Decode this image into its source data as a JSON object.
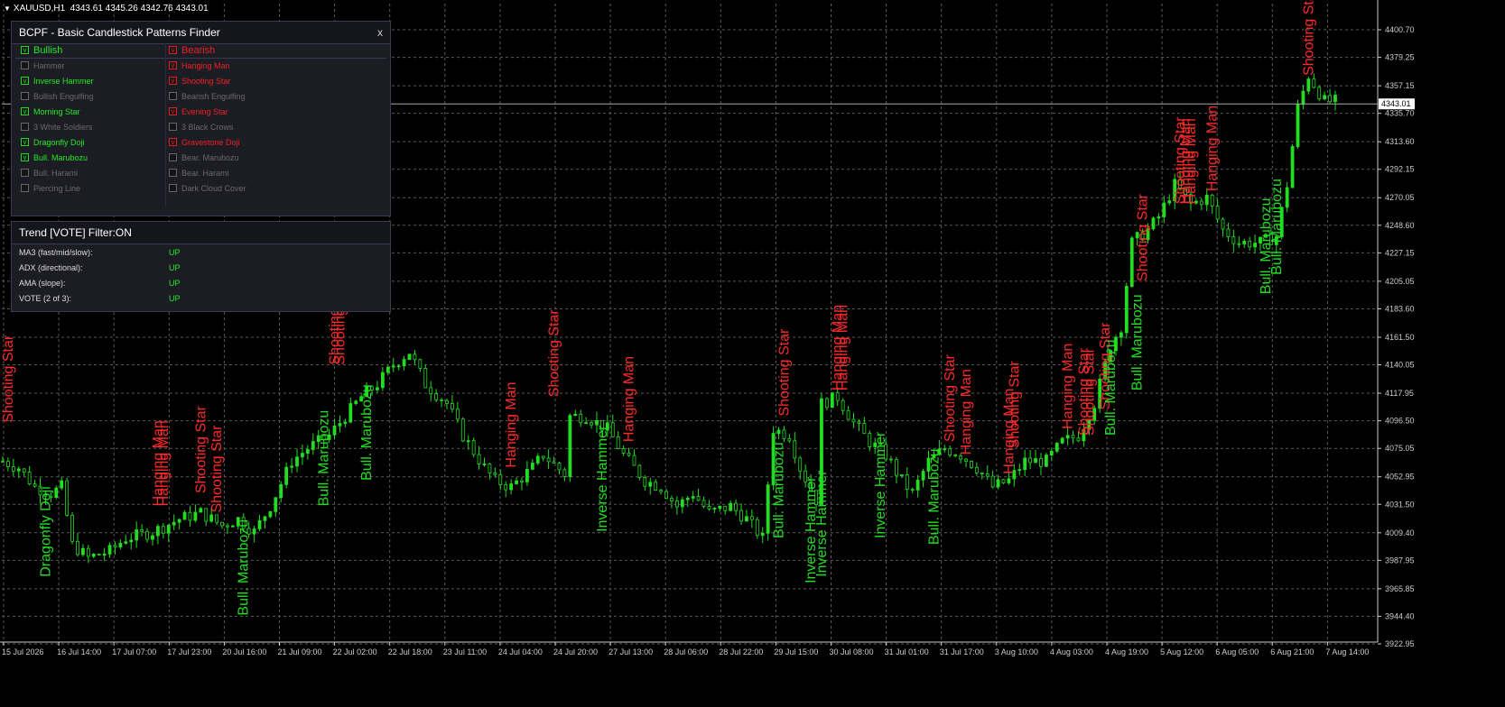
{
  "symbol": {
    "name": "XAUUSD,H1",
    "ohlc": "4343.61 4345.26 4342.76 4343.01"
  },
  "colors": {
    "background": "#000000",
    "grid": "#5a5a5a",
    "bull": "#22dd22",
    "bear": "#ff2a2a",
    "axis": "#cccccc"
  },
  "panel": {
    "title": "BCPF - Basic Candlestick Patterns Finder",
    "close": "x",
    "bullish_header": "Bullish",
    "bearish_header": "Bearish",
    "bullish": [
      {
        "label": "Hammer",
        "checked": false
      },
      {
        "label": "Inverse Hammer",
        "checked": true
      },
      {
        "label": "Bullish Engulfing",
        "checked": false
      },
      {
        "label": "Morning Star",
        "checked": true
      },
      {
        "label": "3 White Soldiers",
        "checked": false
      },
      {
        "label": "Dragonfly Doji",
        "checked": true
      },
      {
        "label": "Bull. Marubozu",
        "checked": true
      },
      {
        "label": "Bull. Harami",
        "checked": false
      },
      {
        "label": "Piercing Line",
        "checked": false
      }
    ],
    "bearish": [
      {
        "label": "Hanging Man",
        "checked": true
      },
      {
        "label": "Shooting Star",
        "checked": true
      },
      {
        "label": "Bearish Engulfing",
        "checked": false
      },
      {
        "label": "Evening Star",
        "checked": true
      },
      {
        "label": "3 Black Crows",
        "checked": false
      },
      {
        "label": "Gravestone Doji",
        "checked": true
      },
      {
        "label": "Bear. Marubozu",
        "checked": false
      },
      {
        "label": "Bear. Harami",
        "checked": false
      },
      {
        "label": "Dark Cloud Cover",
        "checked": false
      }
    ],
    "check_mark": "v"
  },
  "trend": {
    "title": "Trend [VOTE]  Filter:ON",
    "rows": [
      {
        "label": "MA3 (fast/mid/slow):",
        "value": "UP"
      },
      {
        "label": "ADX (directional):",
        "value": "UP"
      },
      {
        "label": "AMA (slope):",
        "value": "UP"
      },
      {
        "label": "VOTE (2 of 3):",
        "value": "UP"
      }
    ]
  },
  "chart_data": {
    "type": "candlestick",
    "price_axis": [
      "4400.70",
      "4379.25",
      "4357.15",
      "4335.70",
      "4313.60",
      "4292.15",
      "4270.05",
      "4248.60",
      "4227.15",
      "4205.05",
      "4183.60",
      "4161.50",
      "4140.05",
      "4117.95",
      "4096.50",
      "4075.05",
      "4052.95",
      "4031.50",
      "4009.40",
      "3987.95",
      "3965.85",
      "3944.40",
      "3922.95"
    ],
    "time_axis": [
      "15 Jul 2026",
      "16 Jul 14:00",
      "17 Jul 07:00",
      "17 Jul 23:00",
      "20 Jul 16:00",
      "21 Jul 09:00",
      "22 Jul 02:00",
      "22 Jul 18:00",
      "23 Jul 11:00",
      "24 Jul 04:00",
      "24 Jul 20:00",
      "27 Jul 13:00",
      "28 Jul 06:00",
      "28 Jul 22:00",
      "29 Jul 15:00",
      "30 Jul 08:00",
      "31 Jul 01:00",
      "31 Jul 17:00",
      "3 Aug 10:00",
      "4 Aug 03:00",
      "4 Aug 19:00",
      "5 Aug 12:00",
      "6 Aug 05:00",
      "6 Aug 21:00",
      "7 Aug 14:00"
    ],
    "current_price": "4343.01",
    "ylim": [
      3922.95,
      4400.7
    ],
    "price_path": [
      [
        0,
        4065
      ],
      [
        3,
        4060
      ],
      [
        6,
        4045
      ],
      [
        9,
        4040
      ],
      [
        11,
        4045
      ],
      [
        13,
        4000
      ],
      [
        16,
        3990
      ],
      [
        20,
        3995
      ],
      [
        23,
        4005
      ],
      [
        28,
        4010
      ],
      [
        33,
        4020
      ],
      [
        37,
        4025
      ],
      [
        41,
        4015
      ],
      [
        44,
        4020
      ],
      [
        47,
        4010
      ],
      [
        50,
        4030
      ],
      [
        54,
        4065
      ],
      [
        57,
        4075
      ],
      [
        61,
        4085
      ],
      [
        64,
        4100
      ],
      [
        67,
        4115
      ],
      [
        70,
        4125
      ],
      [
        73,
        4140
      ],
      [
        76,
        4150
      ],
      [
        79,
        4125
      ],
      [
        83,
        4110
      ],
      [
        86,
        4085
      ],
      [
        90,
        4060
      ],
      [
        92,
        4050
      ],
      [
        95,
        4045
      ],
      [
        99,
        4060
      ],
      [
        101,
        4070
      ],
      [
        105,
        4055
      ],
      [
        106,
        4100
      ],
      [
        109,
        4100
      ],
      [
        113,
        4090
      ],
      [
        116,
        4070
      ],
      [
        120,
        4050
      ],
      [
        123,
        4045
      ],
      [
        126,
        4030
      ],
      [
        129,
        4040
      ],
      [
        132,
        4025
      ],
      [
        136,
        4030
      ],
      [
        139,
        4020
      ],
      [
        142,
        4005
      ],
      [
        144,
        4090
      ],
      [
        147,
        4085
      ],
      [
        149,
        4060
      ],
      [
        152,
        4035
      ],
      [
        153,
        4110
      ],
      [
        156,
        4115
      ],
      [
        159,
        4095
      ],
      [
        162,
        4080
      ],
      [
        165,
        4070
      ],
      [
        168,
        4050
      ],
      [
        170,
        4040
      ],
      [
        173,
        4065
      ],
      [
        176,
        4075
      ],
      [
        179,
        4070
      ],
      [
        182,
        4060
      ],
      [
        185,
        4045
      ],
      [
        188,
        4050
      ],
      [
        191,
        4065
      ],
      [
        195,
        4065
      ],
      [
        198,
        4080
      ],
      [
        201,
        4085
      ],
      [
        204,
        4110
      ],
      [
        207,
        4155
      ],
      [
        209,
        4170
      ],
      [
        211,
        4235
      ],
      [
        214,
        4245
      ],
      [
        216,
        4255
      ],
      [
        219,
        4280
      ],
      [
        222,
        4265
      ],
      [
        225,
        4270
      ],
      [
        228,
        4245
      ],
      [
        231,
        4235
      ],
      [
        235,
        4235
      ],
      [
        238,
        4240
      ],
      [
        240,
        4280
      ],
      [
        242,
        4340
      ],
      [
        244,
        4365
      ],
      [
        247,
        4345
      ],
      [
        249,
        4345
      ]
    ],
    "bar_count": 250,
    "annotations": [
      {
        "bar": 1,
        "text": "Shooting Star",
        "side": "bear",
        "price": 4095
      },
      {
        "bar": 8,
        "text": "Dragonfly Doji",
        "side": "bull",
        "price": 3975
      },
      {
        "bar": 29,
        "text": "Hanging Man",
        "side": "bear",
        "price": 4030
      },
      {
        "bar": 30,
        "text": "Hanging Man",
        "side": "bear",
        "price": 4030
      },
      {
        "bar": 37,
        "text": "Shooting Star",
        "side": "bear",
        "price": 4040
      },
      {
        "bar": 40,
        "text": "Shooting Star",
        "side": "bear",
        "price": 4025
      },
      {
        "bar": 45,
        "text": "Bull. Marubozu",
        "side": "bull",
        "price": 3945
      },
      {
        "bar": 60,
        "text": "Bull. Marubozu",
        "side": "bull",
        "price": 4030
      },
      {
        "bar": 62,
        "text": "Shooting Star",
        "side": "bear",
        "price": 4140
      },
      {
        "bar": 63,
        "text": "Shooting Star",
        "side": "bear",
        "price": 4140
      },
      {
        "bar": 68,
        "text": "Bull. Marubozu",
        "side": "bull",
        "price": 4050
      },
      {
        "bar": 95,
        "text": "Hanging Man",
        "side": "bear",
        "price": 4060
      },
      {
        "bar": 103,
        "text": "Shooting Star",
        "side": "bear",
        "price": 4115
      },
      {
        "bar": 112,
        "text": "Inverse Hammer",
        "side": "bull",
        "price": 4010
      },
      {
        "bar": 117,
        "text": "Hanging Man",
        "side": "bear",
        "price": 4080
      },
      {
        "bar": 145,
        "text": "Bull. Marubozu",
        "side": "bull",
        "price": 4005
      },
      {
        "bar": 146,
        "text": "Shooting Star",
        "side": "bear",
        "price": 4100
      },
      {
        "bar": 151,
        "text": "Inverse Hammer",
        "side": "bull",
        "price": 3970
      },
      {
        "bar": 153,
        "text": "Inverse Hammer",
        "side": "bull",
        "price": 3975
      },
      {
        "bar": 156,
        "text": "Hanging Man",
        "side": "bear",
        "price": 4120
      },
      {
        "bar": 157,
        "text": "Hanging Man",
        "side": "bear",
        "price": 4120
      },
      {
        "bar": 164,
        "text": "Inverse Hammer",
        "side": "bull",
        "price": 4005
      },
      {
        "bar": 174,
        "text": "Bull. Marubozu",
        "side": "bull",
        "price": 4000
      },
      {
        "bar": 177,
        "text": "Shooting Star",
        "side": "bear",
        "price": 4080
      },
      {
        "bar": 180,
        "text": "Hanging Man",
        "side": "bear",
        "price": 4070
      },
      {
        "bar": 188,
        "text": "Hanging Man",
        "side": "bear",
        "price": 4055
      },
      {
        "bar": 189,
        "text": "Shooting Star",
        "side": "bear",
        "price": 4075
      },
      {
        "bar": 199,
        "text": "Hanging Man",
        "side": "bear",
        "price": 4090
      },
      {
        "bar": 202,
        "text": "Shooting Star",
        "side": "bear",
        "price": 4085
      },
      {
        "bar": 203,
        "text": "Shooting Star",
        "side": "bear",
        "price": 4085
      },
      {
        "bar": 206,
        "text": "Shooting Star",
        "side": "bear",
        "price": 4105
      },
      {
        "bar": 207,
        "text": "Bull. Marubozu",
        "side": "bull",
        "price": 4085
      },
      {
        "bar": 212,
        "text": "Bull. Marubozu",
        "side": "bull",
        "price": 4120
      },
      {
        "bar": 213,
        "text": "Shooting Star",
        "side": "bear",
        "price": 4205
      },
      {
        "bar": 220,
        "text": "Shooting Star",
        "side": "bear",
        "price": 4265
      },
      {
        "bar": 221,
        "text": "Hanging Man",
        "side": "bear",
        "price": 4265
      },
      {
        "bar": 222,
        "text": "Hanging Man",
        "side": "bear",
        "price": 4265
      },
      {
        "bar": 226,
        "text": "Hanging Man",
        "side": "bear",
        "price": 4275
      },
      {
        "bar": 236,
        "text": "Bull. Marubozu",
        "side": "bull",
        "price": 4195
      },
      {
        "bar": 238,
        "text": "Bull. Marubozu",
        "side": "bull",
        "price": 4210
      },
      {
        "bar": 244,
        "text": "Shooting Star",
        "side": "bear",
        "price": 4365
      }
    ]
  }
}
